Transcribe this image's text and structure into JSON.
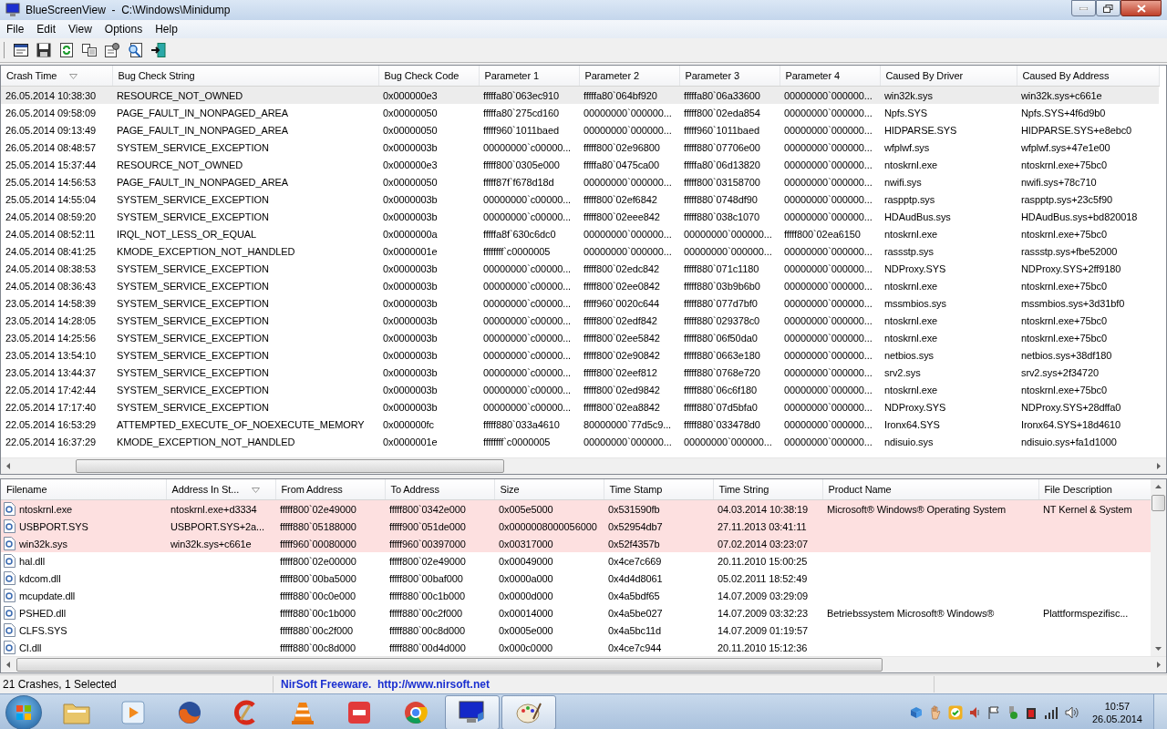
{
  "window": {
    "title": "BlueScreenView  -  C:\\Windows\\Minidump"
  },
  "menu": [
    "File",
    "Edit",
    "View",
    "Options",
    "Help"
  ],
  "crash_table": {
    "columns": [
      {
        "label": "Crash Time",
        "sorted": true
      },
      {
        "label": "Bug Check String",
        "sorted": false
      },
      {
        "label": "Bug Check Code",
        "sorted": false
      },
      {
        "label": "Parameter 1",
        "sorted": false
      },
      {
        "label": "Parameter 2",
        "sorted": false
      },
      {
        "label": "Parameter 3",
        "sorted": false
      },
      {
        "label": "Parameter 4",
        "sorted": false
      },
      {
        "label": "Caused By Driver",
        "sorted": false
      },
      {
        "label": "Caused By Address",
        "sorted": false
      }
    ],
    "rows": [
      {
        "selected": true,
        "cells": [
          "26.05.2014 10:38:30",
          "RESOURCE_NOT_OWNED",
          "0x000000e3",
          "fffffa80`063ec910",
          "fffffa80`064bf920",
          "fffffa80`06a33600",
          "00000000`000000...",
          "win32k.sys",
          "win32k.sys+c661e"
        ]
      },
      {
        "selected": false,
        "cells": [
          "26.05.2014 09:58:09",
          "PAGE_FAULT_IN_NONPAGED_AREA",
          "0x00000050",
          "fffffa80`275cd160",
          "00000000`000000...",
          "fffff800`02eda854",
          "00000000`000000...",
          "Npfs.SYS",
          "Npfs.SYS+4f6d9b0"
        ]
      },
      {
        "selected": false,
        "cells": [
          "26.05.2014 09:13:49",
          "PAGE_FAULT_IN_NONPAGED_AREA",
          "0x00000050",
          "fffff960`1011baed",
          "00000000`000000...",
          "fffff960`1011baed",
          "00000000`000000...",
          "HIDPARSE.SYS",
          "HIDPARSE.SYS+e8ebc0"
        ]
      },
      {
        "selected": false,
        "cells": [
          "26.05.2014 08:48:57",
          "SYSTEM_SERVICE_EXCEPTION",
          "0x0000003b",
          "00000000`c00000...",
          "fffff800`02e96800",
          "fffff880`07706e00",
          "00000000`000000...",
          "wfplwf.sys",
          "wfplwf.sys+47e1e00"
        ]
      },
      {
        "selected": false,
        "cells": [
          "25.05.2014 15:37:44",
          "RESOURCE_NOT_OWNED",
          "0x000000e3",
          "fffff800`0305e000",
          "fffffa80`0475ca00",
          "fffffa80`06d13820",
          "00000000`000000...",
          "ntoskrnl.exe",
          "ntoskrnl.exe+75bc0"
        ]
      },
      {
        "selected": false,
        "cells": [
          "25.05.2014 14:56:53",
          "PAGE_FAULT_IN_NONPAGED_AREA",
          "0x00000050",
          "fffff87f`f678d18d",
          "00000000`000000...",
          "fffff800`03158700",
          "00000000`000000...",
          "nwifi.sys",
          "nwifi.sys+78c710"
        ]
      },
      {
        "selected": false,
        "cells": [
          "25.05.2014 14:55:04",
          "SYSTEM_SERVICE_EXCEPTION",
          "0x0000003b",
          "00000000`c00000...",
          "fffff800`02ef6842",
          "fffff880`0748df90",
          "00000000`000000...",
          "raspptp.sys",
          "raspptp.sys+23c5f90"
        ]
      },
      {
        "selected": false,
        "cells": [
          "24.05.2014 08:59:20",
          "SYSTEM_SERVICE_EXCEPTION",
          "0x0000003b",
          "00000000`c00000...",
          "fffff800`02eee842",
          "fffff880`038c1070",
          "00000000`000000...",
          "HDAudBus.sys",
          "HDAudBus.sys+bd820018"
        ]
      },
      {
        "selected": false,
        "cells": [
          "24.05.2014 08:52:11",
          "IRQL_NOT_LESS_OR_EQUAL",
          "0x0000000a",
          "fffffa8f`630c6dc0",
          "00000000`000000...",
          "00000000`000000...",
          "fffff800`02ea6150",
          "ntoskrnl.exe",
          "ntoskrnl.exe+75bc0"
        ]
      },
      {
        "selected": false,
        "cells": [
          "24.05.2014 08:41:25",
          "KMODE_EXCEPTION_NOT_HANDLED",
          "0x0000001e",
          "ffffffff`c0000005",
          "00000000`000000...",
          "00000000`000000...",
          "00000000`000000...",
          "rassstp.sys",
          "rassstp.sys+fbe52000"
        ]
      },
      {
        "selected": false,
        "cells": [
          "24.05.2014 08:38:53",
          "SYSTEM_SERVICE_EXCEPTION",
          "0x0000003b",
          "00000000`c00000...",
          "fffff800`02edc842",
          "fffff880`071c1180",
          "00000000`000000...",
          "NDProxy.SYS",
          "NDProxy.SYS+2ff9180"
        ]
      },
      {
        "selected": false,
        "cells": [
          "24.05.2014 08:36:43",
          "SYSTEM_SERVICE_EXCEPTION",
          "0x0000003b",
          "00000000`c00000...",
          "fffff800`02ee0842",
          "fffff880`03b9b6b0",
          "00000000`000000...",
          "ntoskrnl.exe",
          "ntoskrnl.exe+75bc0"
        ]
      },
      {
        "selected": false,
        "cells": [
          "23.05.2014 14:58:39",
          "SYSTEM_SERVICE_EXCEPTION",
          "0x0000003b",
          "00000000`c00000...",
          "fffff960`0020c644",
          "fffff880`077d7bf0",
          "00000000`000000...",
          "mssmbios.sys",
          "mssmbios.sys+3d31bf0"
        ]
      },
      {
        "selected": false,
        "cells": [
          "23.05.2014 14:28:05",
          "SYSTEM_SERVICE_EXCEPTION",
          "0x0000003b",
          "00000000`c00000...",
          "fffff800`02edf842",
          "fffff880`029378c0",
          "00000000`000000...",
          "ntoskrnl.exe",
          "ntoskrnl.exe+75bc0"
        ]
      },
      {
        "selected": false,
        "cells": [
          "23.05.2014 14:25:56",
          "SYSTEM_SERVICE_EXCEPTION",
          "0x0000003b",
          "00000000`c00000...",
          "fffff800`02ee5842",
          "fffff880`06f50da0",
          "00000000`000000...",
          "ntoskrnl.exe",
          "ntoskrnl.exe+75bc0"
        ]
      },
      {
        "selected": false,
        "cells": [
          "23.05.2014 13:54:10",
          "SYSTEM_SERVICE_EXCEPTION",
          "0x0000003b",
          "00000000`c00000...",
          "fffff800`02e90842",
          "fffff880`0663e180",
          "00000000`000000...",
          "netbios.sys",
          "netbios.sys+38df180"
        ]
      },
      {
        "selected": false,
        "cells": [
          "23.05.2014 13:44:37",
          "SYSTEM_SERVICE_EXCEPTION",
          "0x0000003b",
          "00000000`c00000...",
          "fffff800`02eef812",
          "fffff880`0768e720",
          "00000000`000000...",
          "srv2.sys",
          "srv2.sys+2f34720"
        ]
      },
      {
        "selected": false,
        "cells": [
          "22.05.2014 17:42:44",
          "SYSTEM_SERVICE_EXCEPTION",
          "0x0000003b",
          "00000000`c00000...",
          "fffff800`02ed9842",
          "fffff880`06c6f180",
          "00000000`000000...",
          "ntoskrnl.exe",
          "ntoskrnl.exe+75bc0"
        ]
      },
      {
        "selected": false,
        "cells": [
          "22.05.2014 17:17:40",
          "SYSTEM_SERVICE_EXCEPTION",
          "0x0000003b",
          "00000000`c00000...",
          "fffff800`02ea8842",
          "fffff880`07d5bfa0",
          "00000000`000000...",
          "NDProxy.SYS",
          "NDProxy.SYS+28dffa0"
        ]
      },
      {
        "selected": false,
        "cells": [
          "22.05.2014 16:53:29",
          "ATTEMPTED_EXECUTE_OF_NOEXECUTE_MEMORY",
          "0x000000fc",
          "fffff880`033a4610",
          "80000000`77d5c9...",
          "fffff880`033478d0",
          "00000000`000000...",
          "Ironx64.SYS",
          "Ironx64.SYS+18d4610"
        ]
      },
      {
        "selected": false,
        "cells": [
          "22.05.2014 16:37:29",
          "KMODE_EXCEPTION_NOT_HANDLED",
          "0x0000001e",
          "ffffffff`c0000005",
          "00000000`000000...",
          "00000000`000000...",
          "00000000`000000...",
          "ndisuio.sys",
          "ndisuio.sys+fa1d1000"
        ]
      }
    ]
  },
  "module_table": {
    "columns": [
      {
        "label": "Filename",
        "sorted": false
      },
      {
        "label": "Address In St...",
        "sorted": true
      },
      {
        "label": "From Address",
        "sorted": false
      },
      {
        "label": "To Address",
        "sorted": false
      },
      {
        "label": "Size",
        "sorted": false
      },
      {
        "label": "Time Stamp",
        "sorted": false
      },
      {
        "label": "Time String",
        "sorted": false
      },
      {
        "label": "Product Name",
        "sorted": false
      },
      {
        "label": "File Description",
        "sorted": false
      }
    ],
    "rows": [
      {
        "highlighted": true,
        "filename": "ntoskrnl.exe",
        "address_in_stack": "ntoskrnl.exe+d3334",
        "from_address": "fffff800`02e49000",
        "to_address": "fffff800`0342e000",
        "size": "0x005e5000",
        "time_stamp": "0x531590fb",
        "time_string": "04.03.2014 10:38:19",
        "product_name": "Microsoft® Windows® Operating System",
        "file_description": "NT Kernel & System"
      },
      {
        "highlighted": true,
        "filename": "USBPORT.SYS",
        "address_in_stack": "USBPORT.SYS+2a...",
        "from_address": "fffff880`05188000",
        "to_address": "fffff900`051de000",
        "size": "0x0000008000056000",
        "time_stamp": "0x52954db7",
        "time_string": "27.11.2013 03:41:11"
      },
      {
        "highlighted": true,
        "filename": "win32k.sys",
        "address_in_stack": "win32k.sys+c661e",
        "from_address": "fffff960`00080000",
        "to_address": "fffff960`00397000",
        "size": "0x00317000",
        "time_stamp": "0x52f4357b",
        "time_string": "07.02.2014 03:23:07"
      },
      {
        "highlighted": false,
        "filename": "hal.dll",
        "from_address": "fffff800`02e00000",
        "to_address": "fffff800`02e49000",
        "size": "0x00049000",
        "time_stamp": "0x4ce7c669",
        "time_string": "20.11.2010 15:00:25"
      },
      {
        "highlighted": false,
        "filename": "kdcom.dll",
        "from_address": "fffff800`00ba5000",
        "to_address": "fffff800`00baf000",
        "size": "0x0000a000",
        "time_stamp": "0x4d4d8061",
        "time_string": "05.02.2011 18:52:49"
      },
      {
        "highlighted": false,
        "filename": "mcupdate.dll",
        "from_address": "fffff880`00c0e000",
        "to_address": "fffff880`00c1b000",
        "size": "0x0000d000",
        "time_stamp": "0x4a5bdf65",
        "time_string": "14.07.2009 03:29:09"
      },
      {
        "highlighted": false,
        "filename": "PSHED.dll",
        "from_address": "fffff880`00c1b000",
        "to_address": "fffff880`00c2f000",
        "size": "0x00014000",
        "time_stamp": "0x4a5be027",
        "time_string": "14.07.2009 03:32:23",
        "product_name": "Betriebssystem Microsoft® Windows®",
        "file_description": "Plattformspezifisc..."
      },
      {
        "highlighted": false,
        "filename": "CLFS.SYS",
        "from_address": "fffff880`00c2f000",
        "to_address": "fffff880`00c8d000",
        "size": "0x0005e000",
        "time_stamp": "0x4a5bc11d",
        "time_string": "14.07.2009 01:19:57"
      },
      {
        "highlighted": false,
        "filename": "CI.dll",
        "from_address": "fffff880`00c8d000",
        "to_address": "fffff880`00d4d000",
        "size": "0x000c0000",
        "time_stamp": "0x4ce7c944",
        "time_string": "20.11.2010 15:12:36"
      }
    ]
  },
  "status_bar": {
    "count": "21 Crashes, 1 Selected",
    "link": "NirSoft Freeware.  http://www.nirsoft.net"
  },
  "taskbar": {
    "apps": [
      {
        "kind": "folder",
        "open": false
      },
      {
        "kind": "player",
        "open": false
      },
      {
        "kind": "firefox",
        "open": false
      },
      {
        "kind": "cleaner",
        "open": false
      },
      {
        "kind": "cone",
        "open": false
      },
      {
        "kind": "mp3",
        "open": false
      },
      {
        "kind": "chrome",
        "open": false
      },
      {
        "kind": "monitor",
        "open": true
      },
      {
        "kind": "palette",
        "open": true
      }
    ],
    "clock": {
      "time": "10:57",
      "date": "26.05.2014"
    }
  }
}
